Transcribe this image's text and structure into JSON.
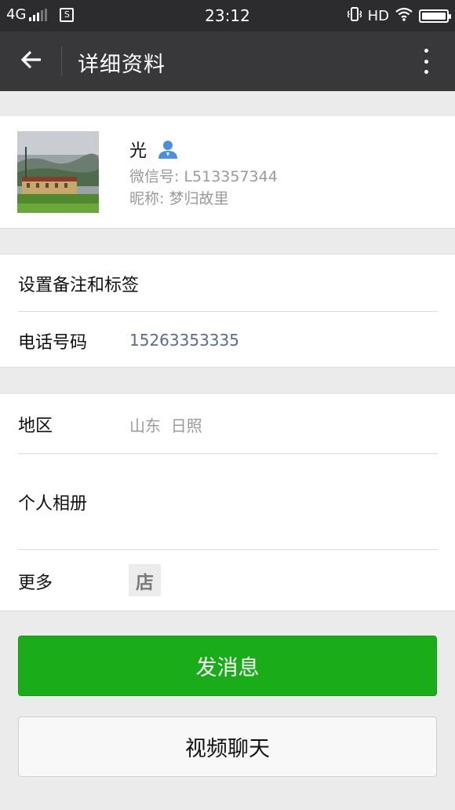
{
  "status_bar": {
    "network": "4G",
    "time": "23:12",
    "hd_label": "HD",
    "sim_label": "S"
  },
  "nav": {
    "title": "详细资料"
  },
  "profile": {
    "name": "光",
    "wechat_id": "微信号: L513357344",
    "nickname": "昵称: 梦归故里"
  },
  "rows": {
    "remark_label": "设置备注和标签",
    "phone_label": "电话号码",
    "phone_value": "15263353335",
    "region_label": "地区",
    "region_value": "山东  日照",
    "album_label": "个人相册",
    "more_label": "更多",
    "shop_tag": "店"
  },
  "buttons": {
    "send_message": "发消息",
    "video_chat": "视频聊天"
  },
  "colors": {
    "primary_green": "#1aad19",
    "link_blue": "#576b95",
    "verified_blue": "#4a90e2"
  },
  "icons": [
    "back-arrow-icon",
    "more-vertical-icon",
    "person-verified-icon",
    "shop-icon",
    "vibrate-icon",
    "wifi-icon",
    "battery-icon",
    "signal-icon"
  ]
}
